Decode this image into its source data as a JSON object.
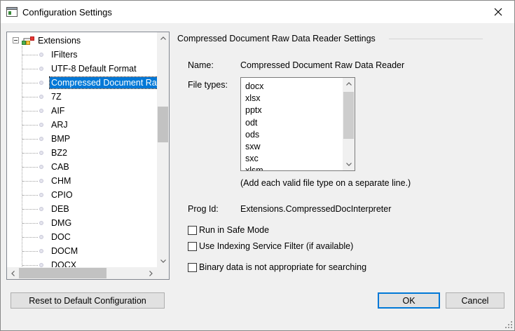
{
  "window": {
    "title": "Configuration Settings",
    "icon": "settings-window-icon",
    "close_icon": "close-icon"
  },
  "tree": {
    "root_label": "Extensions",
    "items": [
      {
        "label": "IFilters"
      },
      {
        "label": "UTF-8 Default Format"
      },
      {
        "label": "Compressed Document Raw Data Reader",
        "selected": true
      },
      {
        "label": "7Z"
      },
      {
        "label": "AIF"
      },
      {
        "label": "ARJ"
      },
      {
        "label": "BMP"
      },
      {
        "label": "BZ2"
      },
      {
        "label": "CAB"
      },
      {
        "label": "CHM"
      },
      {
        "label": "CPIO"
      },
      {
        "label": "DEB"
      },
      {
        "label": "DMG"
      },
      {
        "label": "DOC"
      },
      {
        "label": "DOCM"
      },
      {
        "label": "DOCX"
      }
    ]
  },
  "settings": {
    "group_title": "Compressed Document Raw Data Reader Settings",
    "name_label": "Name:",
    "name_value": "Compressed Document Raw Data Reader",
    "file_types_label": "File types:",
    "file_types": [
      "docx",
      "xlsx",
      "pptx",
      "odt",
      "ods",
      "sxw",
      "sxc",
      "xlsm"
    ],
    "file_types_hint": "(Add each valid file type on a separate line.)",
    "prog_id_label": "Prog Id:",
    "prog_id_value": "Extensions.CompressedDocInterpreter",
    "checkboxes": [
      {
        "label": "Run in Safe Mode",
        "checked": false
      },
      {
        "label": "Use Indexing Service Filter (if available)",
        "checked": false
      },
      {
        "label": "Binary data is not appropriate for searching",
        "checked": false
      }
    ]
  },
  "buttons": {
    "reset": "Reset to Default Configuration",
    "ok": "OK",
    "cancel": "Cancel"
  },
  "colors": {
    "selection": "#0078d7",
    "default_button_border": "#0078d7"
  }
}
